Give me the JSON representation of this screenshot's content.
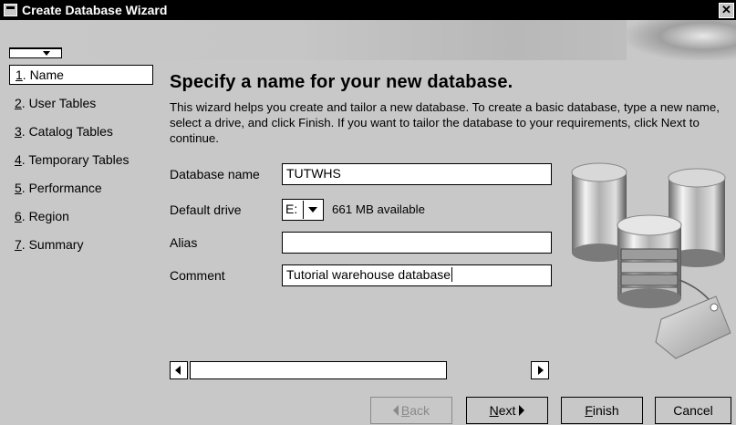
{
  "window": {
    "title": "Create Database Wizard",
    "close_glyph": "✕"
  },
  "steps": [
    {
      "num": "1",
      "label": ". Name",
      "active": true
    },
    {
      "num": "2",
      "label": ". User Tables"
    },
    {
      "num": "3",
      "label": ". Catalog Tables"
    },
    {
      "num": "4",
      "label": ". Temporary Tables"
    },
    {
      "num": "5",
      "label": ". Performance"
    },
    {
      "num": "6",
      "label": ". Region"
    },
    {
      "num": "7",
      "label": ". Summary"
    }
  ],
  "content": {
    "heading": "Specify a name for your new database.",
    "intro": "This wizard helps you create and tailor a new database. To create a basic database, type a new name, select a drive, and click Finish. If you want to tailor the database to your requirements, click Next to continue."
  },
  "form": {
    "db_name_label": "Database name",
    "db_name_value": "TUTWHS",
    "drive_label": "Default drive",
    "drive_value": "E:",
    "drive_available": "661 MB available",
    "alias_label": "Alias",
    "alias_value": "",
    "comment_label": "Comment",
    "comment_value": "Tutorial warehouse database"
  },
  "buttons": {
    "back_mn": "B",
    "back_rest": "ack",
    "next_mn": "N",
    "next_rest": "ext",
    "finish_mn": "F",
    "finish_rest": "inish",
    "cancel": "Cancel"
  },
  "icons": {
    "art": "database-cylinders-illustration"
  }
}
